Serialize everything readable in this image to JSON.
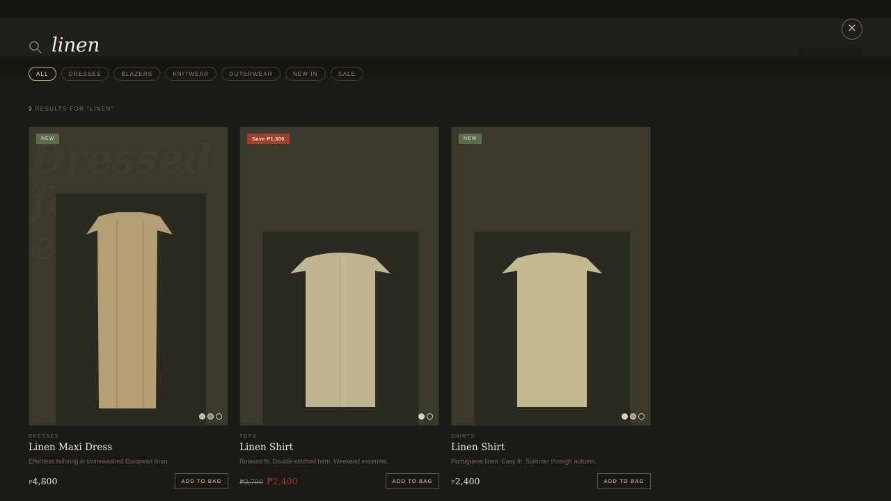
{
  "search": {
    "query": "linen"
  },
  "filters": [
    {
      "label": "ALL",
      "active": true
    },
    {
      "label": "DRESSES",
      "active": false
    },
    {
      "label": "BLAZERS",
      "active": false
    },
    {
      "label": "KNITWEAR",
      "active": false
    },
    {
      "label": "OUTERWEAR",
      "active": false
    },
    {
      "label": "NEW IN",
      "active": false
    },
    {
      "label": "SALE",
      "active": false
    }
  ],
  "results": {
    "count": "3",
    "label": "RESULTS FOR \"LINEN\""
  },
  "products": [
    {
      "badge": "NEW",
      "category": "DRESSES",
      "name": "Linen Maxi Dress",
      "description": "Effortless tailoring in stonewashed European linen.",
      "currency": "₱",
      "price": "4,800",
      "button": "ADD TO BAG",
      "ghost_text": "Dressed\nfo\ne     s",
      "swatches": [
        "#c9b98f",
        "#8c7f98",
        "#2f3a2b"
      ],
      "garment_color": "#b39e73"
    },
    {
      "badge": "Save ₱1,300",
      "category": "TOPS",
      "name": "Linen Shirt",
      "description": "Relaxed fit. Double-stitched hem. Weekend essential.",
      "old_price": "₱3,700",
      "sale_price": "₱2,400",
      "button": "ADD TO BAG",
      "swatches": [
        "#dcd4b8",
        "#2f3a2b"
      ],
      "garment_color": "#c2b690"
    },
    {
      "badge": "NEW",
      "category": "SHIRTS",
      "name": "Linen Shirt",
      "description": "Portuguese linen. Easy fit. Summer through autumn.",
      "currency": "₱",
      "price": "2,400",
      "button": "ADD TO BAG",
      "swatches": [
        "#dcd4b8",
        "#9c9a90",
        "#2b2a22"
      ],
      "garment_color": "#c4b990"
    }
  ],
  "colors": {
    "background": "#1b1a15",
    "card": "#3a372b",
    "accent_new": "#5d6e4a",
    "accent_sale": "#a2402c"
  }
}
